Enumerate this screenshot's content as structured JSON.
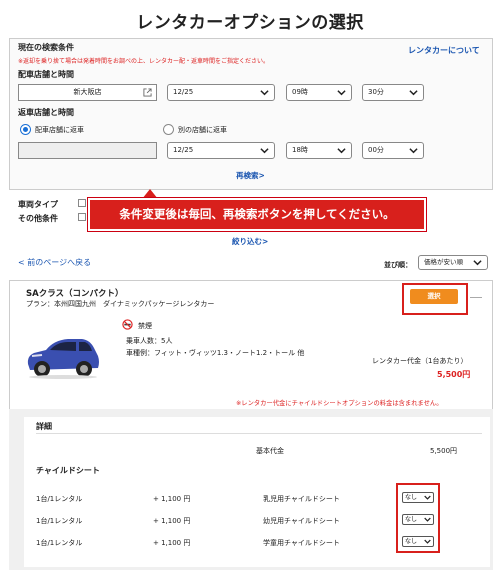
{
  "page_title": "レンタカーオプションの選択",
  "search": {
    "heading": "現在の検索条件",
    "note": "※返却を乗り捨て場合は発着時間をお調べの上、レンタカー配・返車時間をご指定ください。",
    "about_link": "レンタカーについて",
    "pickup_heading": "配車店舗と時間",
    "pickup_store": "新大阪店",
    "pickup_date": "12/25",
    "pickup_hour": "09時",
    "pickup_min": "30分",
    "return_heading": "返車店舗と時間",
    "return_same_label": "配車店舗に返車",
    "return_other_label": "別の店舗に返車",
    "return_store": "",
    "return_date": "12/25",
    "return_hour": "18時",
    "return_min": "00分",
    "research_link": "再検索>"
  },
  "filters": {
    "vehicle_type_label": "車両タイプ",
    "other_label": "その他条件",
    "narrow_link": "絞り込む>"
  },
  "callout": {
    "text": "条件変更後は毎回、再検索ボタンを押してください。"
  },
  "nav": {
    "back_link": "< 前のページへ戻る",
    "sort_label": "並び順：",
    "sort_value": "価格が安い順"
  },
  "car": {
    "class_name": "SAクラス（コンパクト）",
    "plan": "プラン：本州四国九州　ダイナミックパッケージレンタカー",
    "select_button": "選択",
    "smoking": "禁煙",
    "capacity": "乗車人数：5人",
    "examples": "車種例：フィット・ヴィッツ1.3・ノート1.2・トール 他",
    "fee_label": "レンタカー代金（1台あたり）",
    "fee_value": "5,500円",
    "fee_note": "※レンタカー代金にチャイルドシートオプションの料金は含まれません。",
    "body_color": "#3a4fb0"
  },
  "details": {
    "heading": "詳細",
    "base_label": "基本代金",
    "base_value": "5,500円",
    "child_seat_heading": "チャイルドシート",
    "rows": [
      {
        "unit": "1台/1レンタル",
        "price": "+ 1,100 円",
        "name": "乳児用チャイルドシート",
        "option": "なし"
      },
      {
        "unit": "1台/1レンタル",
        "price": "+ 1,100 円",
        "name": "幼児用チャイルドシート",
        "option": "なし"
      },
      {
        "unit": "1台/1レンタル",
        "price": "+ 1,100 円",
        "name": "学童用チャイルドシート",
        "option": "なし"
      }
    ]
  },
  "colors": {
    "accent_red": "#d8201c",
    "link_blue": "#1a55b0",
    "select_orange": "#f08c1e"
  }
}
